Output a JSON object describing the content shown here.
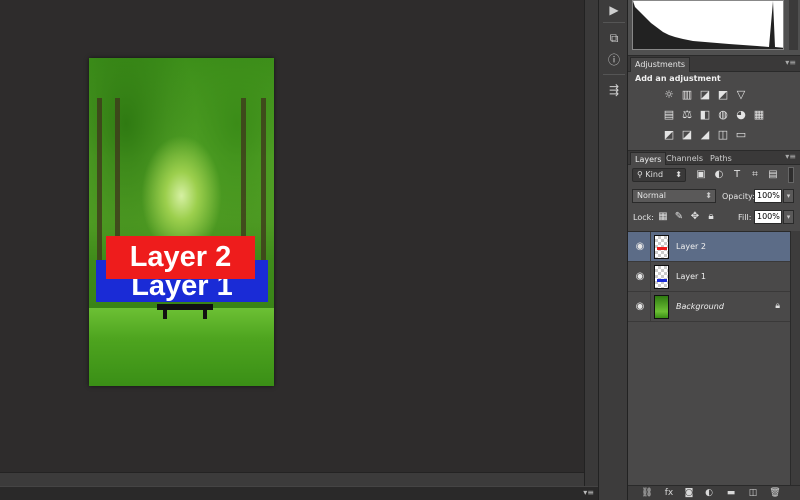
{
  "document": {
    "layer2_text": "Layer 2",
    "layer1_text": "Layer 1",
    "layer2_color": "#ee1c1c",
    "layer1_color": "#1a2bd6"
  },
  "tools": [
    "play-icon",
    "layer-comps-icon",
    "info-icon",
    "history-icon"
  ],
  "adjustments": {
    "tab_label": "Adjustments",
    "title": "Add an adjustment",
    "icons_row1": [
      "☼",
      "▥",
      "◪",
      "◩",
      "▽"
    ],
    "icons_row2": [
      "▤",
      "⚖",
      "◧",
      "◍",
      "◕",
      "▦"
    ],
    "icons_row3": [
      "◩",
      "◪",
      "◢",
      "◫",
      "▭"
    ]
  },
  "layers_panel": {
    "tabs": [
      "Layers",
      "Channels",
      "Paths"
    ],
    "filter_kind": "Kind",
    "blend_mode": "Normal",
    "opacity_label": "Opacity:",
    "opacity_value": "100%",
    "lock_label": "Lock:",
    "fill_label": "Fill:",
    "fill_value": "100%",
    "layers": [
      {
        "name": "Layer 2",
        "selected": true,
        "italic": false,
        "locked": false
      },
      {
        "name": "Layer 1",
        "selected": false,
        "italic": false,
        "locked": false
      },
      {
        "name": "Background",
        "selected": false,
        "italic": true,
        "locked": true
      }
    ],
    "selection_color": "#5c6c87"
  },
  "footer_icons": [
    "link-icon",
    "fx-icon",
    "mask-icon",
    "adjustment-layer-icon",
    "folder-icon",
    "new-layer-icon",
    "trash-icon"
  ]
}
